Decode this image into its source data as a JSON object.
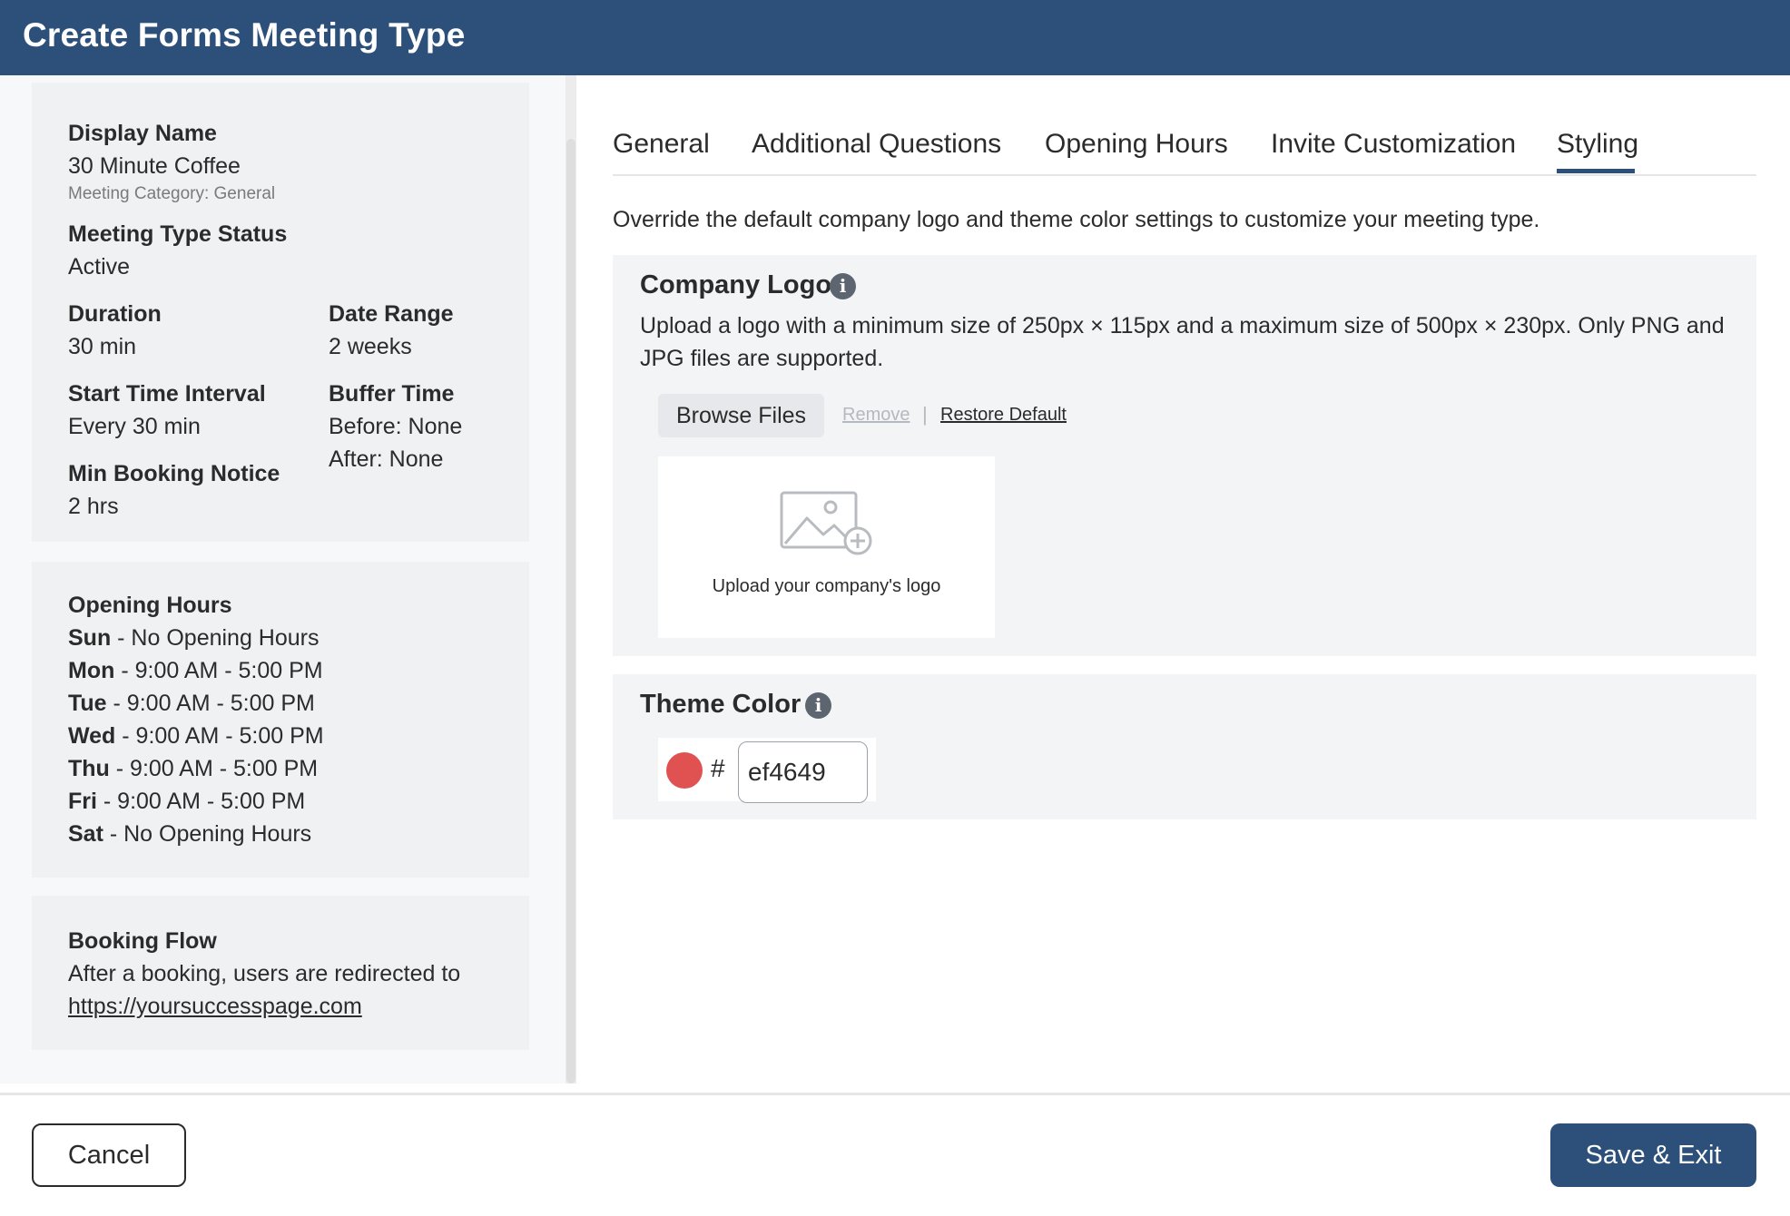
{
  "header": {
    "title": "Create Forms Meeting Type"
  },
  "summary": {
    "display_name_label": "Display Name",
    "display_name": "30 Minute Coffee",
    "meeting_category": "Meeting Category: General",
    "status_label": "Meeting Type Status",
    "status": "Active",
    "duration_label": "Duration",
    "duration": "30 min",
    "date_range_label": "Date Range",
    "date_range": "2 weeks",
    "start_interval_label": "Start Time Interval",
    "start_interval": "Every 30 min",
    "buffer_label": "Buffer Time",
    "buffer_before": "Before: None",
    "buffer_after": "After: None",
    "min_notice_label": "Min Booking Notice",
    "min_notice": "2 hrs"
  },
  "opening_hours": {
    "title": "Opening Hours",
    "days": [
      {
        "day": "Sun",
        "hours": " - No Opening Hours"
      },
      {
        "day": "Mon",
        "hours": " - 9:00 AM - 5:00 PM"
      },
      {
        "day": "Tue",
        "hours": " - 9:00 AM - 5:00 PM"
      },
      {
        "day": "Wed",
        "hours": " - 9:00 AM - 5:00 PM"
      },
      {
        "day": "Thu",
        "hours": " - 9:00 AM - 5:00 PM"
      },
      {
        "day": "Fri",
        "hours": " - 9:00 AM - 5:00 PM"
      },
      {
        "day": "Sat",
        "hours": " - No Opening Hours"
      }
    ]
  },
  "booking_flow": {
    "title": "Booking Flow",
    "text": "After a booking, users are redirected to",
    "url": "https://yoursuccesspage.com"
  },
  "tabs": [
    {
      "label": "General"
    },
    {
      "label": "Additional Questions"
    },
    {
      "label": "Opening Hours"
    },
    {
      "label": "Invite Customization"
    },
    {
      "label": "Styling",
      "active": true
    }
  ],
  "styling": {
    "intro": "Override the default company logo and theme color settings to customize your meeting type.",
    "company_logo": {
      "title": "Company Logo",
      "description": "Upload a logo with a minimum size of 250px × 115px and a maximum size of 500px × 230px. Only PNG and JPG files are supported.",
      "browse_label": "Browse Files",
      "remove_label": "Remove",
      "separator": "|",
      "restore_label": "Restore Default",
      "upload_placeholder": "Upload your company's logo"
    },
    "theme_color": {
      "title": "Theme Color",
      "hash": "#",
      "value": "ef4649",
      "swatch_color": "#e05252"
    },
    "info_glyph": "i"
  },
  "footer": {
    "cancel_label": "Cancel",
    "save_label": "Save & Exit"
  },
  "colors": {
    "brand": "#2c5079",
    "panel_bg": "#f0f1f3",
    "section_bg": "#f3f4f6"
  }
}
